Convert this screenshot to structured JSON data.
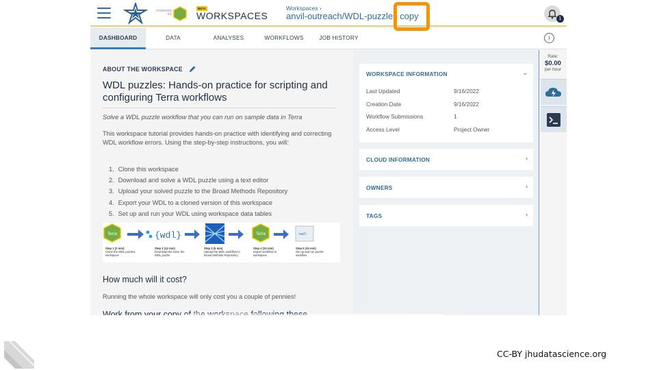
{
  "header": {
    "powered_by": "POWERED BY",
    "terra_logo_text": "Terra",
    "beta_badge": "BETA",
    "brand": "WORKSPACES",
    "breadcrumb_parent": "Workspaces ›",
    "workspace_name": "anvil-outreach/WDL-puzzles copy",
    "notification_count": "1"
  },
  "tabs": [
    {
      "label": "DASHBOARD",
      "active": true
    },
    {
      "label": "DATA"
    },
    {
      "label": "ANALYSES"
    },
    {
      "label": "WORKFLOWS"
    },
    {
      "label": "JOB HISTORY"
    }
  ],
  "about": {
    "heading": "ABOUT THE WORKSPACE",
    "title": "WDL puzzles: Hands-on practice for scripting and configuring Terra workflows",
    "subtitle": "Solve a WDL puzzle workflow that you can run on sample data in Terra",
    "description": "This workspace tutorial provides hands-on practice with identifying and correcting WDL workflow errors. Using the step-by-step instructions, you will:",
    "steps": [
      "Clone this workspace",
      "Download and solve a WDL puzzle using a text editor",
      "Upload your solved puzzle to the Broad Methods Repository",
      "Export your WDL to a cloned version of this workspace",
      "Set up and run your WDL using workspace data tables"
    ],
    "flow": {
      "terra_label": "Terra",
      "wdl_label": "{wdl}",
      "file_label": ">wdl",
      "captions": [
        {
          "title": "Step 1 (2 min)",
          "text": "Clone the WDL puzzles workspace"
        },
        {
          "title": "Step 2 (12 min)",
          "text": "Download the solve the WDL puzzle"
        },
        {
          "title": "Step 3 (5 min)",
          "text": "Upload the WDL workflow to Broad Methods Repository"
        },
        {
          "title": "Step 4 (10 min)",
          "text": "Export workflow to workspace"
        },
        {
          "title": "Step 5 (15 min)",
          "text": "Set up and run puzzle workflow"
        }
      ]
    },
    "cost_heading": "How much will it cost?",
    "cost_text": "Running the whole workspace will only cost you a couple of pennies!",
    "cut_text": "Work from your copy of the workspace following these"
  },
  "workspace_info": {
    "heading": "WORKSPACE INFORMATION",
    "rows": [
      {
        "label": "Last Updated",
        "value": "9/16/2022"
      },
      {
        "label": "Creation Date",
        "value": "9/16/2022"
      },
      {
        "label": "Workflow Submissions",
        "value": "1"
      },
      {
        "label": "Access Level",
        "value": "Project Owner"
      }
    ]
  },
  "sections": {
    "cloud": "CLOUD INFORMATION",
    "owners": "OWNERS",
    "tags": "TAGS"
  },
  "rail": {
    "rate_label": "Rate:",
    "rate_value": "$0.00",
    "rate_unit": "per hour"
  },
  "footer": {
    "license": "CC-BY  jhudatascience.org"
  },
  "colors": {
    "accent_blue": "#2f6d9c",
    "highlight_orange": "#f59400",
    "terra_green": "#74ae43"
  }
}
